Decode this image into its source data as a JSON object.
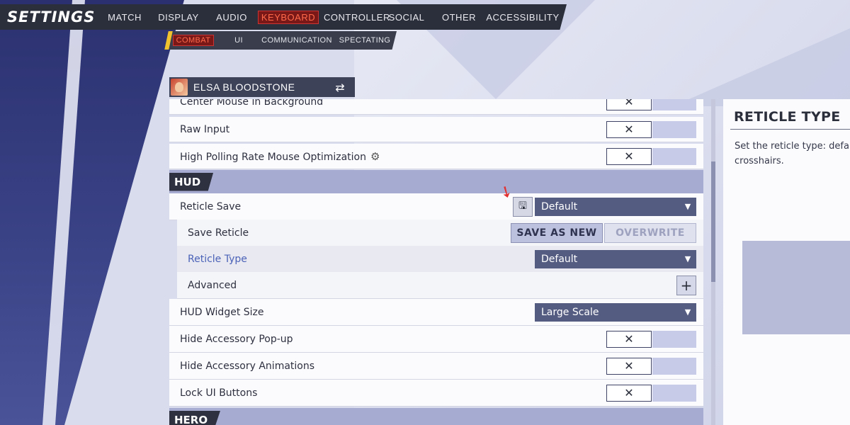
{
  "header": {
    "title": "SETTINGS",
    "tabs": [
      "MATCH",
      "DISPLAY",
      "AUDIO",
      "KEYBOARD",
      "CONTROLLER",
      "SOCIAL",
      "OTHER",
      "ACCESSIBILITY"
    ],
    "active_tab": "KEYBOARD"
  },
  "subnav": {
    "tabs": [
      "COMBAT",
      "UI",
      "COMMUNICATION",
      "SPECTATING"
    ],
    "active_tab": "COMBAT"
  },
  "hero": {
    "name": "ELSA BLOODSTONE",
    "swap_icon": "swap-arrows-icon"
  },
  "settings": {
    "center_mouse": "Center Mouse in Background",
    "raw_input": "Raw Input",
    "high_polling": "High Polling Rate Mouse Optimization",
    "hud_section": "HUD",
    "reticle_save": "Reticle Save",
    "reticle_save_value": "Default",
    "save_reticle": "Save Reticle",
    "save_as_new": "SAVE AS NEW",
    "overwrite": "OVERWRITE",
    "reticle_type": "Reticle Type",
    "reticle_type_value": "Default",
    "advanced": "Advanced",
    "hud_widget_size": "HUD Widget Size",
    "hud_widget_size_value": "Large Scale",
    "hide_accessory_popup": "Hide Accessory Pop-up",
    "hide_accessory_animations": "Hide Accessory Animations",
    "lock_ui_buttons": "Lock UI Buttons",
    "hero_section": "HERO",
    "toggle_off_symbol": "✕"
  },
  "panel": {
    "title": "RETICLE TYPE",
    "description_line1": "Set the reticle type: defaul",
    "description_line2": "crosshairs."
  },
  "colors": {
    "accent_active": "#7a1818",
    "dropdown_bg": "#555c82",
    "section_bg": "#a6abd1",
    "annotation_arrow": "#e23030"
  }
}
